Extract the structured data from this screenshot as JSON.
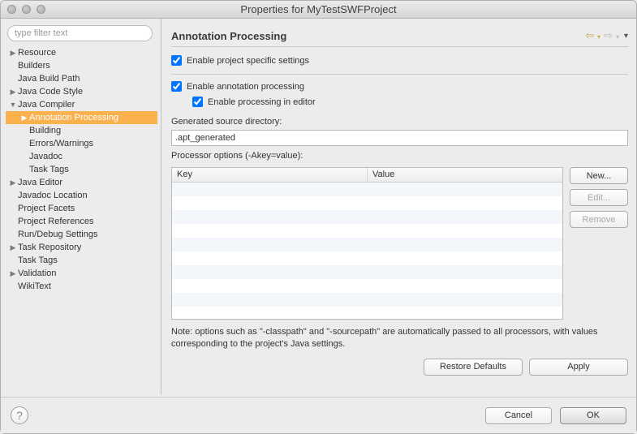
{
  "window": {
    "title": "Properties for MyTestSWFProject"
  },
  "filter": {
    "placeholder": "type filter text"
  },
  "tree": [
    {
      "label": "Resource",
      "lv": 0,
      "tw": "right"
    },
    {
      "label": "Builders",
      "lv": 0,
      "tw": ""
    },
    {
      "label": "Java Build Path",
      "lv": 0,
      "tw": ""
    },
    {
      "label": "Java Code Style",
      "lv": 0,
      "tw": "right"
    },
    {
      "label": "Java Compiler",
      "lv": 0,
      "tw": "down"
    },
    {
      "label": "Annotation Processing",
      "lv": 1,
      "tw": "right",
      "sel": true
    },
    {
      "label": "Building",
      "lv": 1,
      "tw": ""
    },
    {
      "label": "Errors/Warnings",
      "lv": 1,
      "tw": ""
    },
    {
      "label": "Javadoc",
      "lv": 1,
      "tw": ""
    },
    {
      "label": "Task Tags",
      "lv": 1,
      "tw": ""
    },
    {
      "label": "Java Editor",
      "lv": 0,
      "tw": "right"
    },
    {
      "label": "Javadoc Location",
      "lv": 0,
      "tw": ""
    },
    {
      "label": "Project Facets",
      "lv": 0,
      "tw": ""
    },
    {
      "label": "Project References",
      "lv": 0,
      "tw": ""
    },
    {
      "label": "Run/Debug Settings",
      "lv": 0,
      "tw": ""
    },
    {
      "label": "Task Repository",
      "lv": 0,
      "tw": "right"
    },
    {
      "label": "Task Tags",
      "lv": 0,
      "tw": ""
    },
    {
      "label": "Validation",
      "lv": 0,
      "tw": "right"
    },
    {
      "label": "WikiText",
      "lv": 0,
      "tw": ""
    }
  ],
  "page": {
    "heading": "Annotation Processing",
    "enable_project": "Enable project specific settings",
    "enable_ap": "Enable annotation processing",
    "enable_editor": "Enable processing in editor",
    "gensrc_label": "Generated source directory:",
    "gensrc_value": ".apt_generated",
    "procopt_label": "Processor options (-Akey=value):",
    "col_key": "Key",
    "col_value": "Value",
    "btn_new": "New...",
    "btn_edit": "Edit...",
    "btn_remove": "Remove",
    "note": "Note: options such as \"-classpath\" and \"-sourcepath\" are automatically passed to all processors, with values corresponding to the project's Java settings.",
    "restore": "Restore Defaults",
    "apply": "Apply"
  },
  "footer": {
    "cancel": "Cancel",
    "ok": "OK"
  }
}
